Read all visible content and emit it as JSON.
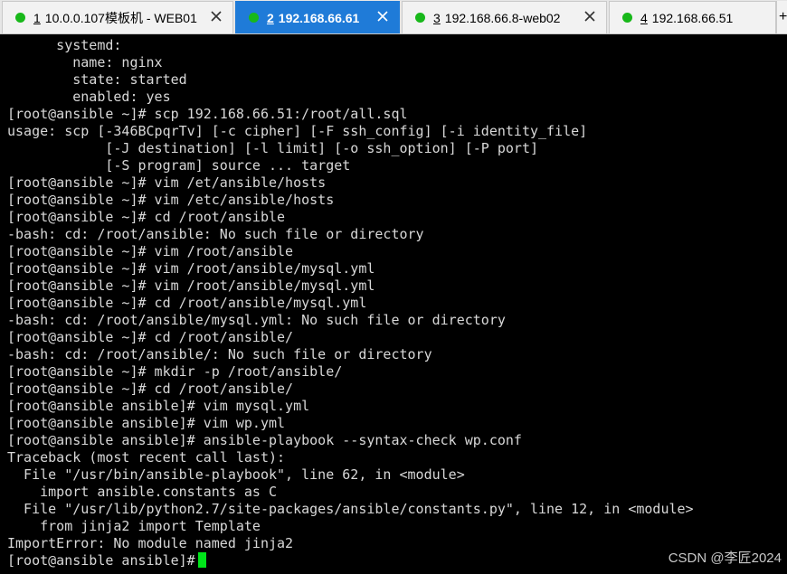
{
  "tabs": [
    {
      "number": "1",
      "title": "10.0.0.107模板机 - WEB01",
      "active": false,
      "status_color": "#18b81a"
    },
    {
      "number": "2",
      "title": "192.168.66.61",
      "active": true,
      "status_color": "#18b81a"
    },
    {
      "number": "3",
      "title": "192.168.66.8-web02",
      "active": false,
      "status_color": "#18b81a"
    },
    {
      "number": "4",
      "title": "192.168.66.51",
      "active": false,
      "status_color": "#18b81a"
    }
  ],
  "tab_overflow_label": "+",
  "terminal": {
    "lines": [
      "      systemd:",
      "        name: nginx",
      "        state: started",
      "        enabled: yes",
      "[root@ansible ~]# scp 192.168.66.51:/root/all.sql",
      "usage: scp [-346BCpqrTv] [-c cipher] [-F ssh_config] [-i identity_file]",
      "            [-J destination] [-l limit] [-o ssh_option] [-P port]",
      "            [-S program] source ... target",
      "[root@ansible ~]# vim /et/ansible/hosts",
      "[root@ansible ~]# vim /etc/ansible/hosts",
      "[root@ansible ~]# cd /root/ansible",
      "-bash: cd: /root/ansible: No such file or directory",
      "[root@ansible ~]# vim /root/ansible",
      "[root@ansible ~]# vim /root/ansible/mysql.yml",
      "[root@ansible ~]# vim /root/ansible/mysql.yml",
      "[root@ansible ~]# cd /root/ansible/mysql.yml",
      "-bash: cd: /root/ansible/mysql.yml: No such file or directory",
      "[root@ansible ~]# cd /root/ansible/",
      "-bash: cd: /root/ansible/: No such file or directory",
      "[root@ansible ~]# mkdir -p /root/ansible/",
      "[root@ansible ~]# cd /root/ansible/",
      "[root@ansible ansible]# vim mysql.yml",
      "[root@ansible ansible]# vim wp.yml",
      "[root@ansible ansible]# ansible-playbook --syntax-check wp.conf",
      "Traceback (most recent call last):",
      "  File \"/usr/bin/ansible-playbook\", line 62, in <module>",
      "    import ansible.constants as C",
      "  File \"/usr/lib/python2.7/site-packages/ansible/constants.py\", line 12, in <module>",
      "    from jinja2 import Template",
      "ImportError: No module named jinja2"
    ],
    "prompt": "[root@ansible ansible]# ",
    "cursor_color": "#00e51a",
    "text_color": "#d8d8d8",
    "background": "#000000"
  },
  "watermark": "CSDN @李匠2024"
}
